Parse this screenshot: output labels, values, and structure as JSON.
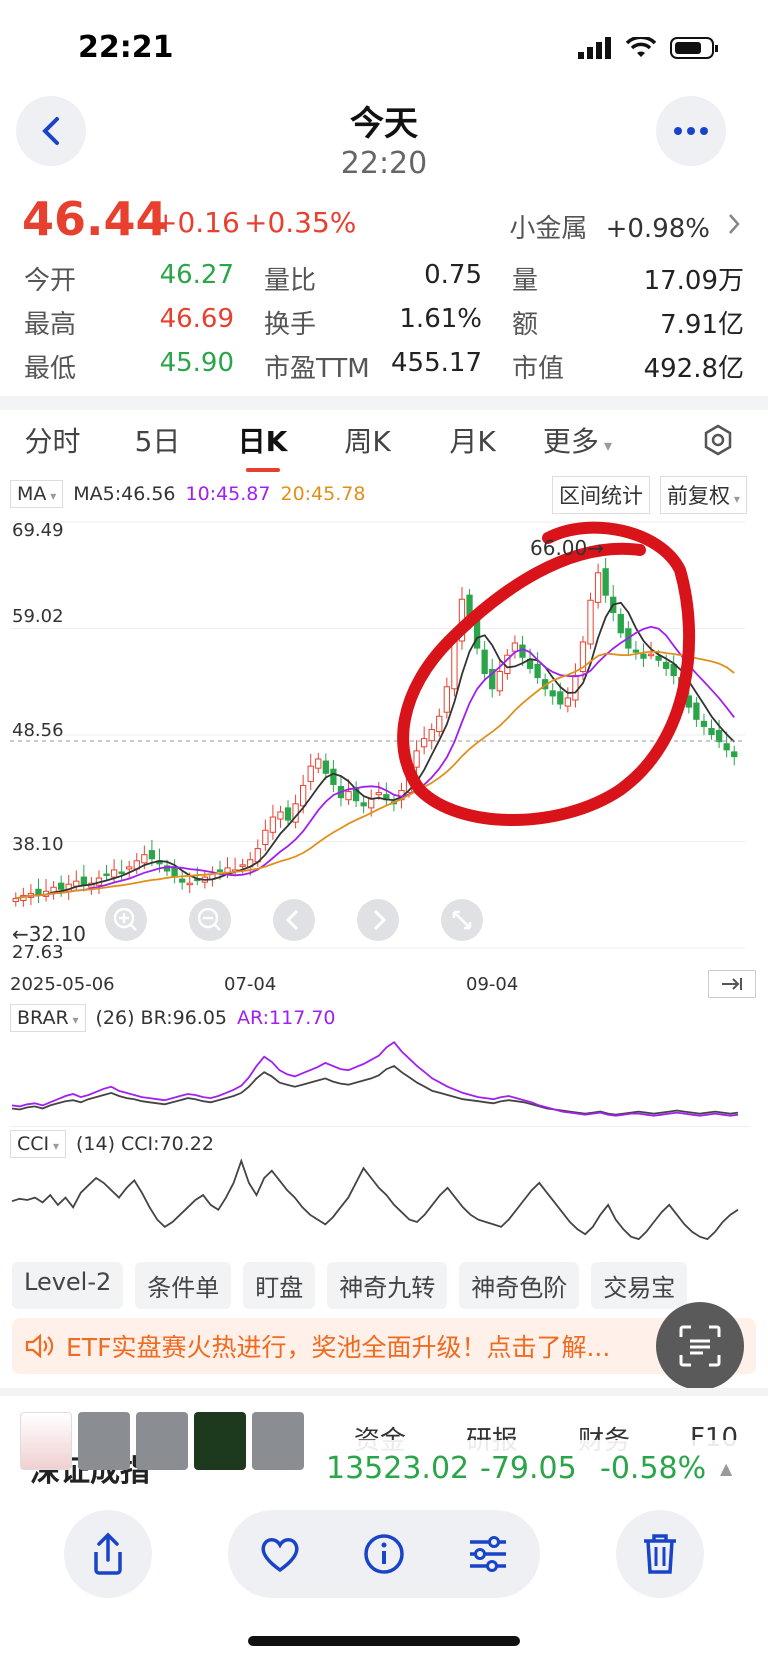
{
  "status": {
    "time": "22:21"
  },
  "header": {
    "title": "今天",
    "subtitle": "22:20"
  },
  "quote": {
    "price": "46.44",
    "change": "+0.16",
    "change_pct": "+0.35%",
    "sector_name": "小金属",
    "sector_change": "+0.98%"
  },
  "stats": {
    "rows": [
      [
        {
          "label": "今开",
          "value": "46.27",
          "color": "green"
        },
        {
          "label": "量比",
          "value": "0.75",
          "color": "dark"
        },
        {
          "label": "量",
          "value": "17.09万",
          "color": "dark"
        }
      ],
      [
        {
          "label": "最高",
          "value": "46.69",
          "color": "red"
        },
        {
          "label": "换手",
          "value": "1.61%",
          "color": "dark"
        },
        {
          "label": "额",
          "value": "7.91亿",
          "color": "dark"
        }
      ],
      [
        {
          "label": "最低",
          "value": "45.90",
          "color": "green"
        },
        {
          "label": "市盈TTM",
          "value": "455.17",
          "color": "dark"
        },
        {
          "label": "市值",
          "value": "492.8亿",
          "color": "dark"
        }
      ]
    ]
  },
  "tabs": [
    "分时",
    "5日",
    "日K",
    "周K",
    "月K",
    "更多"
  ],
  "chart": {
    "ma_selector": "MA",
    "ma5": "MA5:46.56",
    "ma10": "10:45.87",
    "ma20": "20:45.78",
    "range_stats": "区间统计",
    "adjust": "前复权",
    "y_ticks": [
      "69.49",
      "59.02",
      "48.56",
      "38.10",
      "27.63"
    ],
    "high_marker": "66.00→",
    "low_marker": "←32.10",
    "x_ticks": [
      "2025-05-06",
      "07-04",
      "09-04"
    ],
    "brar_selector": "BRAR",
    "brar_params": "(26) BR:96.05",
    "ar_value": "AR:117.70",
    "cci_selector": "CCI",
    "cci_params": "(14) CCI:70.22"
  },
  "chart_data": {
    "type": "candlestick",
    "ylim": [
      27.63,
      69.49
    ],
    "x_ticks": [
      "2025-05-06",
      "07-04",
      "09-04"
    ],
    "ma_colors": {
      "ma5": "#333333",
      "ma10": "#a020f0",
      "ma20": "#e0901a"
    },
    "close": [
      32.5,
      32.8,
      33.0,
      32.9,
      33.2,
      33.6,
      33.4,
      33.9,
      34.2,
      33.8,
      34.0,
      34.5,
      34.8,
      35.3,
      35.0,
      35.6,
      36.2,
      36.8,
      36.4,
      35.9,
      35.2,
      34.6,
      34.1,
      34.0,
      34.3,
      34.6,
      34.9,
      35.2,
      35.5,
      35.3,
      35.8,
      36.3,
      37.4,
      39.2,
      40.5,
      41.0,
      40.2,
      41.8,
      43.6,
      45.5,
      46.2,
      44.8,
      43.7,
      42.4,
      43.0,
      42.1,
      41.6,
      42.3,
      42.9,
      42.2,
      41.8,
      43.1,
      45.6,
      47.0,
      48.2,
      49.1,
      50.4,
      53.3,
      58.0,
      61.9,
      60.2,
      57.1,
      54.6,
      53.1,
      54.8,
      56.4,
      57.6,
      56.2,
      55.1,
      54.2,
      53.1,
      52.4,
      51.6,
      52.2,
      54.4,
      57.7,
      61.8,
      64.5,
      62.3,
      60.6,
      58.6,
      57.1,
      56.7,
      56.1,
      56.5,
      55.9,
      55.1,
      54.4,
      52.6,
      51.3,
      50.1,
      49.4,
      48.6,
      47.9,
      47.1,
      46.44
    ]
  },
  "indicators": {
    "br": [
      45,
      44,
      46,
      47,
      45,
      48,
      50,
      52,
      53,
      51,
      54,
      56,
      58,
      60,
      57,
      55,
      54,
      52,
      51,
      50,
      49,
      51,
      53,
      55,
      54,
      52,
      51,
      53,
      55,
      57,
      60,
      66,
      74,
      80,
      76,
      70,
      68,
      66,
      68,
      70,
      72,
      74,
      71,
      69,
      68,
      70,
      72,
      74,
      77,
      83,
      86,
      80,
      75,
      70,
      66,
      62,
      60,
      58,
      56,
      54,
      53,
      52,
      51,
      50,
      52,
      53,
      52,
      51,
      49,
      47,
      45,
      44,
      43,
      42,
      41,
      40,
      41,
      42,
      40,
      39,
      40,
      41,
      42,
      41,
      40,
      41,
      42,
      43,
      42,
      41,
      40,
      41,
      42,
      41,
      40,
      41
    ],
    "ar": [
      48,
      47,
      49,
      50,
      48,
      51,
      54,
      57,
      59,
      56,
      58,
      61,
      64,
      66,
      62,
      60,
      58,
      56,
      55,
      54,
      53,
      55,
      57,
      59,
      58,
      56,
      55,
      57,
      60,
      63,
      67,
      75,
      86,
      95,
      90,
      82,
      78,
      76,
      79,
      82,
      85,
      89,
      86,
      83,
      82,
      85,
      88,
      92,
      96,
      104,
      109,
      100,
      93,
      86,
      80,
      74,
      70,
      66,
      63,
      60,
      58,
      56,
      55,
      54,
      56,
      57,
      55,
      53,
      51,
      48,
      46,
      44,
      42,
      41,
      40,
      39,
      40,
      41,
      39,
      38,
      39,
      40,
      40,
      39,
      38,
      39,
      40,
      41,
      40,
      39,
      38,
      39,
      40,
      39,
      38,
      39
    ],
    "cci": [
      55,
      57,
      56,
      58,
      54,
      60,
      52,
      58,
      50,
      62,
      68,
      74,
      70,
      64,
      58,
      66,
      72,
      62,
      50,
      40,
      34,
      38,
      44,
      50,
      56,
      60,
      52,
      48,
      58,
      70,
      88,
      70,
      60,
      74,
      80,
      72,
      64,
      58,
      50,
      44,
      40,
      36,
      42,
      50,
      58,
      70,
      82,
      74,
      66,
      60,
      52,
      46,
      40,
      38,
      44,
      52,
      60,
      66,
      58,
      50,
      44,
      40,
      38,
      36,
      34,
      40,
      48,
      56,
      64,
      70,
      62,
      54,
      46,
      38,
      32,
      28,
      34,
      44,
      52,
      40,
      32,
      26,
      24,
      30,
      38,
      46,
      52,
      44,
      36,
      30,
      26,
      24,
      30,
      38,
      44,
      48
    ]
  },
  "shortcuts": [
    "Level-2",
    "条件单",
    "盯盘",
    "神奇九转",
    "神奇色阶",
    "交易宝"
  ],
  "banner": {
    "text": "ETF实盘赛火热进行，奖池全面升级！点击了解..."
  },
  "bottom_tabs": [
    "资金",
    "研报",
    "财务",
    "F10"
  ],
  "index_bar": {
    "name": "深证成指",
    "value": "13523.02",
    "change": "-79.05",
    "change_pct": "-0.58%"
  },
  "colors": {
    "up": "#e8402f",
    "down": "#2aa54a",
    "accent": "#1a44c8",
    "annotation": "#d8141a"
  }
}
